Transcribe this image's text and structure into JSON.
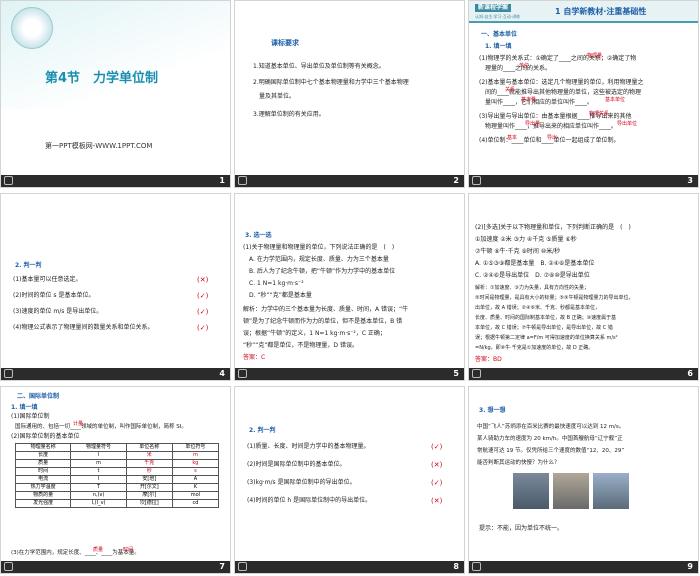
{
  "s1": {
    "num": "1",
    "title": "第4节　力学单位制",
    "footer": "第一PPT模板网-WWW.1PPT.COM"
  },
  "s2": {
    "num": "2",
    "heading": "课标要求",
    "lines": [
      "1.知道基本单位、导出单位及单位制等有关概念。",
      "2.明确国际单位制中七个基本物理量和力学中三个基本物理",
      "　量及其单位。",
      "3.理解单位制的有关应用。"
    ]
  },
  "s3": {
    "num": "3",
    "banner": "新课程学案",
    "banner_sub": "认知·自主·学习·互动·讲练",
    "head": "1 自学新教材·注重基础性",
    "sec": "一、基本单位",
    "sub": "1. 填一填",
    "lines": [
      "(1)物理学的关系式：①确定了____之间的关系；②确定了物",
      "　理量的____之间的关系。",
      "(2)基本量与基本单位：选定几个物理量的单位，利用物理量之",
      "　间的____就能推导出其他物理量的单位，这些被选定的物理",
      "　量叫作____，它们相应的单位叫作____。",
      "(3)导出量与导出单位：由基本量根据____推导出来的其他",
      "　物理量叫作____，推导出来的相应单位叫作____。",
      "(4)单位制：____单位和____单位一起组成了单位制。"
    ],
    "fills": [
      "物理量",
      "单位",
      "关系",
      "基本量",
      "基本单位",
      "物理关系",
      "导出量",
      "导出单位",
      "基本",
      "导出"
    ]
  },
  "s4": {
    "num": "4",
    "sub": "2. 判一判",
    "items": [
      {
        "text": "(1)基本量可以任意选定。",
        "mark": "(✕)"
      },
      {
        "text": "(2)时间的单位 s 是基本单位。",
        "mark": "(✓)"
      },
      {
        "text": "(3)速度的单位 m/s 是导出单位。",
        "mark": "(✓)"
      },
      {
        "text": "(4)物理公式表示了物理量间的数量关系和单位关系。",
        "mark": "(✓)"
      }
    ]
  },
  "s5": {
    "num": "5",
    "sub": "3. 选一选",
    "q": [
      "(1)关于物理量和物理量的单位，下列说法正确的是　(　)",
      "　A. 在力学范围内，规定长度、质量、力为三个基本量",
      "　B. 后人为了纪念牛顿，把“牛顿”作为力学中的基本单位",
      "　C. 1 N=1 kg·m·s⁻²",
      "　D. “秒”“克”都是基本量"
    ],
    "a": [
      "解析：力学中的三个基本量为长度、质量、时间，A 错误；“牛",
      "顿”是为了纪念牛顿而作为力的单位，但不是基本单位，B 错",
      "误；根据“牛顿”的定义，1 N=1 kg·m·s⁻²，C 正确；",
      "“秒”“克”都是单位，不是物理量，D 错误。"
    ],
    "ans": "答案：C"
  },
  "s6": {
    "num": "6",
    "q": [
      "(2)[多选]关于以下物理量和单位，下列判断正确的是　(　)",
      "①加速度 ②米 ③力 ④千克 ⑤质量 ⑥秒",
      "⑦牛顿 ⑧牛·千克 ⑨时间 ⑩米/秒",
      "A. ①⑤③⑨都是基本量　B. ②④⑥是基本单位",
      "C. ②④⑥是导出单位　D. ⑦⑧⑩是导出单位"
    ],
    "a": [
      "解析：①加速度、③力为矢量，具有方向性的矢量；",
      "⑤时间是物理量，是具有大小的标量；⑤⑨牛顿是物理量力的导出单位，",
      "出单位，故 A 错误；②④⑥米、千克、秒都是基本单位，",
      "长度、质量、时间的国际制基本单位，故 B 正确；⑩速度属于基",
      "本单位，故 C 错误；⑦牛顿是导出单位，是导出单位，故 C 错",
      "误；根据牛顿第二定律 a=F/m 可得加速度的单位换算关系 m/s²",
      "=N/kg，即⑧牛·千克是①加速度的单位，故 D 正确。"
    ],
    "ans": "答案：BD"
  },
  "s7": {
    "num": "7",
    "sec": "二、国际单位制",
    "sub": "1. 填一填",
    "p1": "(1)国际单位制",
    "p2": "国际通用的、包括一切____领域的单位制，叫作国际单位制，简称 SI。",
    "fill": "计量",
    "p3": "(2)国际单位制的基本单位",
    "headers": [
      "物理量名称",
      "物理量符号",
      "单位名称",
      "单位符号"
    ],
    "rows": [
      [
        "长度",
        "l",
        "米",
        "m"
      ],
      [
        "质量",
        "m",
        "千克",
        "kg"
      ],
      [
        "时间",
        "t",
        "秒",
        "s"
      ],
      [
        "电流",
        "I",
        "安[培]",
        "A"
      ],
      [
        "热力学温度",
        "T",
        "开[尔文]",
        "K"
      ],
      [
        "物质的量",
        "n,(ν)",
        "摩[尔]",
        "mol"
      ],
      [
        "发光强度",
        "I,(I_v)",
        "坎[德拉]",
        "cd"
      ]
    ],
    "p4": "(3)在力学范围内，规定长度、____、____为基本量。",
    "fills": [
      "质量",
      "时间"
    ]
  },
  "s8": {
    "num": "8",
    "sub": "2. 判一判",
    "items": [
      {
        "text": "(1)质量、长度、时间是力学中的基本物理量。",
        "mark": "(✓)"
      },
      {
        "text": "(2)时间是国际单位制中的基本单位。",
        "mark": "(✕)"
      },
      {
        "text": "(3)kg·m/s 是国际单位制中的导出单位。",
        "mark": "(✓)"
      },
      {
        "text": "(4)时间的单位 h 是国际单位制中的导出单位。",
        "mark": "(✕)"
      }
    ]
  },
  "s9": {
    "num": "9",
    "sub": "3. 想一想",
    "lines": [
      "中国“飞人”苏炳添在百米比赛的最快速度可以达到 12 m/s。",
      "某人骑助力车的速度为 20 km/h。中国首艘航母“辽宁舰”正",
      "常航速可达 19 节。仅凭所给三个速度的数值“12、20、29”",
      "能否判断其运动的快慢？为什么？"
    ],
    "hint": "提示：不能，因为单位不统一。"
  }
}
